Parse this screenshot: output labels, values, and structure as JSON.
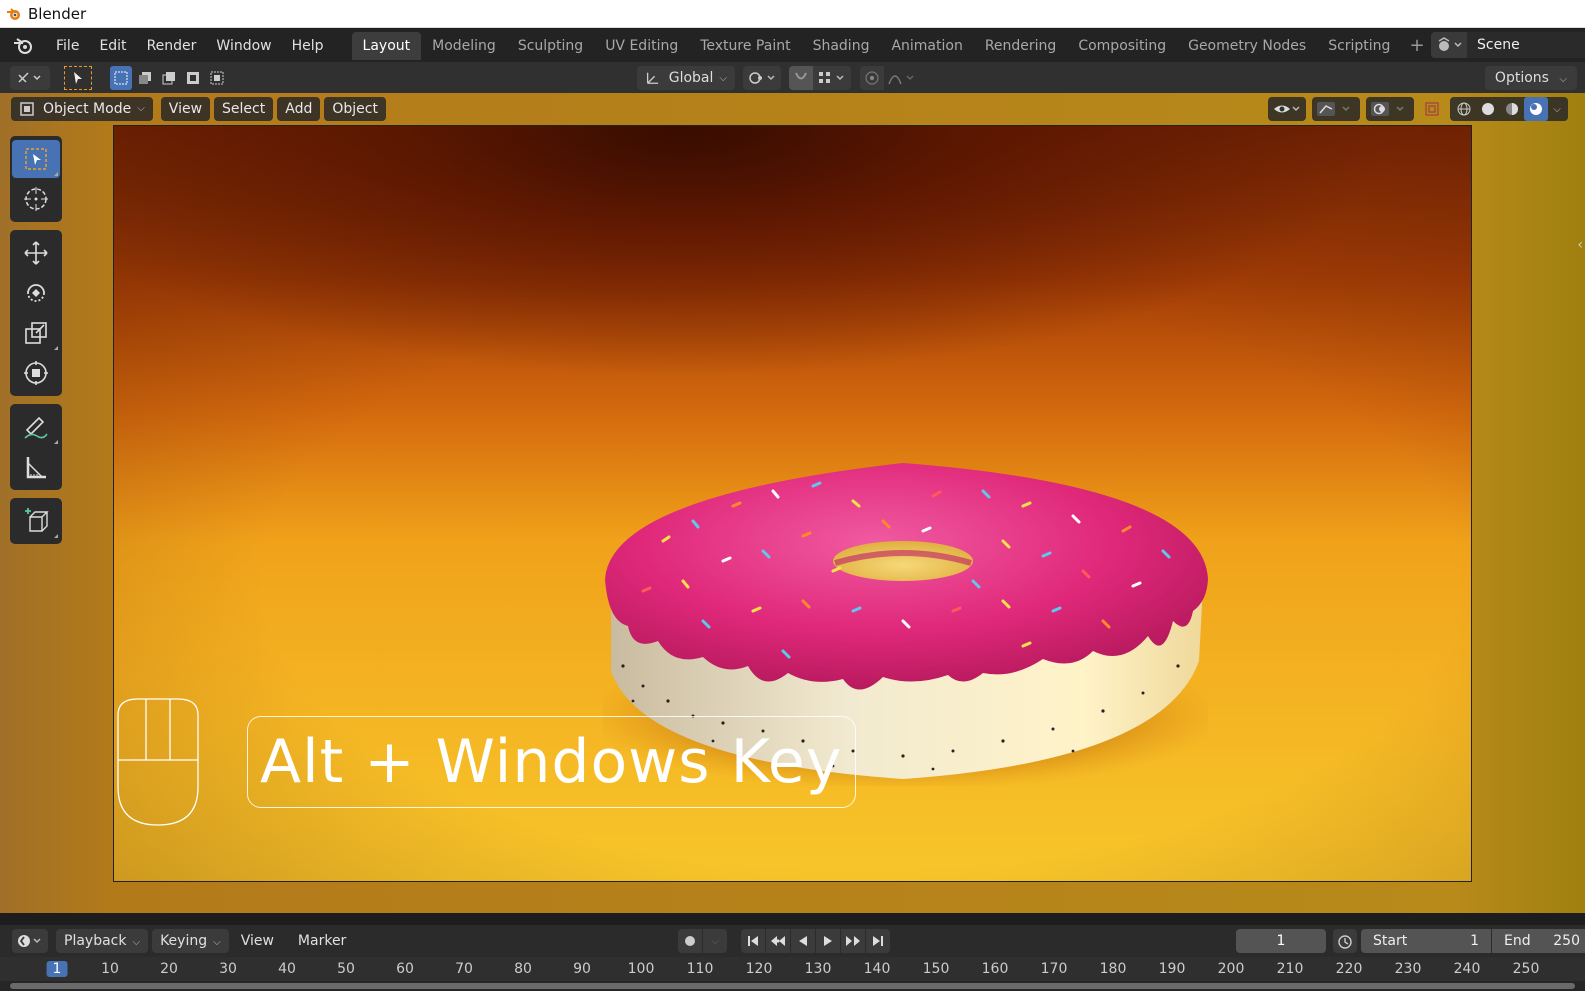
{
  "window": {
    "title": "Blender"
  },
  "menu": [
    "File",
    "Edit",
    "Render",
    "Window",
    "Help"
  ],
  "workspaces": [
    "Layout",
    "Modeling",
    "Sculpting",
    "UV Editing",
    "Texture Paint",
    "Shading",
    "Animation",
    "Rendering",
    "Compositing",
    "Geometry Nodes",
    "Scripting"
  ],
  "active_workspace": "Layout",
  "scene": {
    "name": "Scene"
  },
  "tool_header": {
    "orientation": "Global",
    "options_label": "Options"
  },
  "viewport_header": {
    "mode": "Object Mode",
    "menus": [
      "View",
      "Select",
      "Add",
      "Object"
    ]
  },
  "overlay": {
    "key_text": "Alt + Windows Key"
  },
  "timeline": {
    "menus": [
      "Playback",
      "Keying",
      "View",
      "Marker"
    ],
    "current_frame": "1",
    "start_label": "Start",
    "start_value": "1",
    "end_label": "End",
    "end_value": "250",
    "ticks": [
      "1",
      "10",
      "20",
      "30",
      "40",
      "50",
      "60",
      "70",
      "80",
      "90",
      "100",
      "110",
      "120",
      "130",
      "140",
      "150",
      "160",
      "170",
      "180",
      "190",
      "200",
      "210",
      "220",
      "230",
      "240",
      "250"
    ]
  },
  "colors": {
    "accent": "#4772b3",
    "glaze": "#e0287a",
    "background_warm": "#f4b322"
  }
}
